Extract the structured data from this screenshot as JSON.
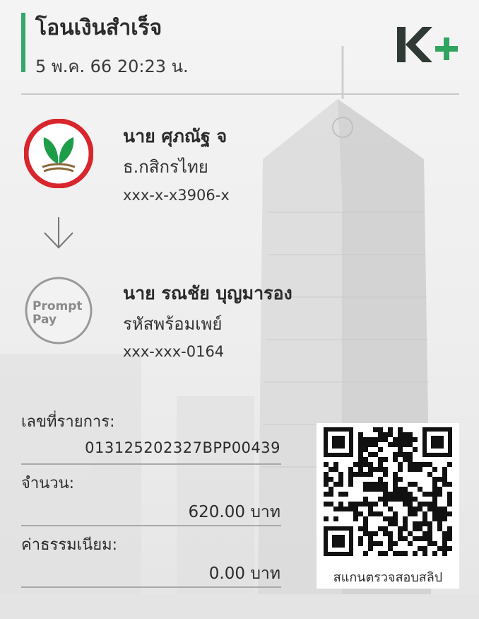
{
  "header": {
    "title": "โอนเงินสำเร็จ",
    "datetime": "5 พ.ค. 66  20:23 น.",
    "accent_color": "#35a86b",
    "logo": "kplus-logo"
  },
  "sender": {
    "name": "นาย ศุภณัฐ จ",
    "bank": "ธ.กสิกรไทย",
    "account": "xxx-x-x3906-x",
    "logo": "kbank-logo"
  },
  "arrow_icon": "arrow-down-icon",
  "receiver": {
    "name": "นาย รณชัย บุญมารอง",
    "bank": "รหัสพร้อมเพย์",
    "account": "xxx-xxx-0164",
    "logo_line1": "Prompt",
    "logo_line2": "Pay"
  },
  "details": {
    "ref_label": "เลขที่รายการ:",
    "ref_value": "013125202327BPP00439",
    "amount_label": "จำนวน:",
    "amount_value": "620.00 บาท",
    "fee_label": "ค่าธรรมเนียม:",
    "fee_value": "0.00 บาท"
  },
  "qr": {
    "caption": "สแกนตรวจสอบสลิป",
    "icon": "qr-code-icon"
  }
}
